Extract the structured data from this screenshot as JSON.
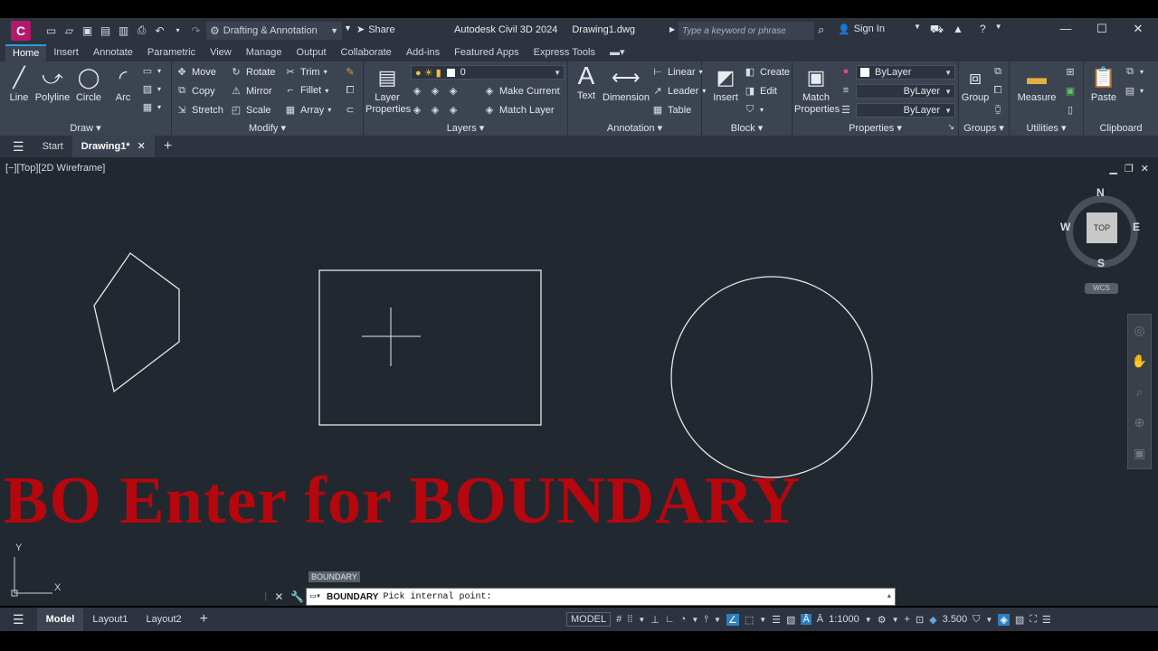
{
  "titlebar": {
    "app_letter": "C",
    "workspace": "Drafting & Annotation",
    "share": "Share",
    "app_name": "Autodesk Civil 3D 2024",
    "file_name": "Drawing1.dwg",
    "search_placeholder": "Type a keyword or phrase",
    "sign_in": "Sign In"
  },
  "ribbon_tabs": [
    "Home",
    "Insert",
    "Annotate",
    "Parametric",
    "View",
    "Manage",
    "Output",
    "Collaborate",
    "Add-ins",
    "Featured Apps",
    "Express Tools"
  ],
  "draw": {
    "title": "Draw",
    "line": "Line",
    "polyline": "Polyline",
    "circle": "Circle",
    "arc": "Arc"
  },
  "modify": {
    "title": "Modify",
    "move": "Move",
    "rotate": "Rotate",
    "trim": "Trim",
    "copy": "Copy",
    "mirror": "Mirror",
    "fillet": "Fillet",
    "stretch": "Stretch",
    "scale": "Scale",
    "array": "Array"
  },
  "layers": {
    "title": "Layers",
    "layer_properties": "Layer\nProperties",
    "current_layer": "0",
    "make_current": "Make Current",
    "match_layer": "Match Layer"
  },
  "annotation": {
    "title": "Annotation",
    "text": "Text",
    "dimension": "Dimension",
    "linear": "Linear",
    "leader": "Leader",
    "table": "Table"
  },
  "block": {
    "title": "Block",
    "insert": "Insert",
    "create": "Create",
    "edit": "Edit"
  },
  "properties": {
    "title": "Properties",
    "match_properties": "Match\nProperties",
    "color": "ByLayer",
    "linetype": "ByLayer",
    "lineweight": "ByLayer"
  },
  "groups": {
    "title": "Groups",
    "group": "Group"
  },
  "utilities": {
    "title": "Utilities",
    "measure": "Measure"
  },
  "clipboard": {
    "title": "Clipboard",
    "paste": "Paste"
  },
  "doc_tabs": {
    "start": "Start",
    "drawing": "Drawing1*"
  },
  "viewport": {
    "label": "[−][Top][2D Wireframe]",
    "cube_top": "TOP",
    "north": "N",
    "south": "S",
    "east": "E",
    "west": "W",
    "wcs": "WCS"
  },
  "ucs": {
    "x": "X",
    "y": "Y"
  },
  "overlay_text": "BO Enter for BOUNDARY",
  "command": {
    "tooltip": "BOUNDARY",
    "name": "BOUNDARY",
    "prompt": "Pick internal point:"
  },
  "layout_tabs": [
    "Model",
    "Layout1",
    "Layout2"
  ],
  "status": {
    "model": "MODEL",
    "scale": "1:1000",
    "annoscale": "3.500"
  }
}
